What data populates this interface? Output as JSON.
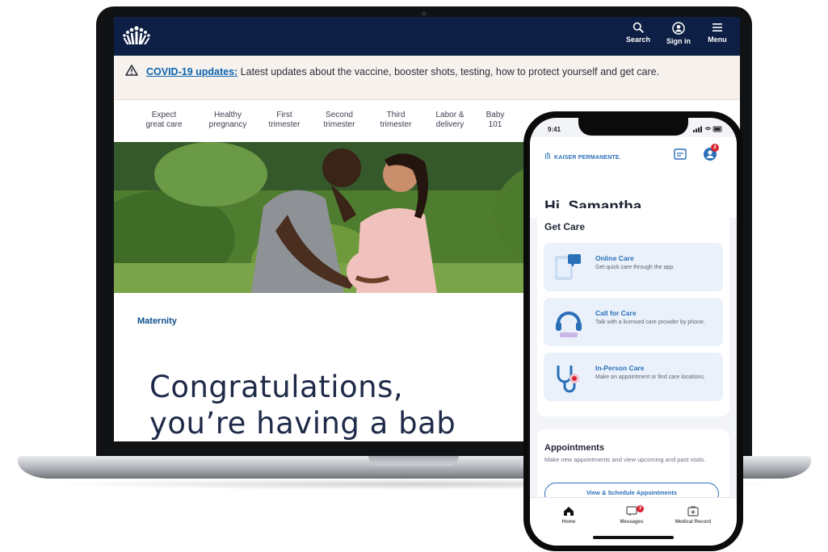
{
  "laptop": {
    "header": {
      "logo_icon": "kaiser-permanente-logo-icon",
      "search_label": "Search",
      "signin_label": "Sign in",
      "menu_label": "Menu",
      "bg_color": "#0d1f44"
    },
    "banner": {
      "icon": "warning-triangle-icon",
      "link_text": "COVID-19 updates:",
      "text": " Latest updates about the vaccine, booster shots, testing, how to protect yourself and get care."
    },
    "tabs": [
      {
        "line1": "Expect",
        "line2": "great care"
      },
      {
        "line1": "Healthy",
        "line2": "pregnancy"
      },
      {
        "line1": "First",
        "line2": "trimester"
      },
      {
        "line1": "Second",
        "line2": "trimester"
      },
      {
        "line1": "Third",
        "line2": "trimester"
      },
      {
        "line1": "Labor &",
        "line2": "delivery"
      },
      {
        "line1": "Baby",
        "line2": "101"
      }
    ],
    "section_label": "Maternity",
    "headline_line1": "Congratulations,",
    "headline_line2": "you’re having a bab"
  },
  "phone": {
    "status_time": "9:41",
    "app_logo_text": "KAISER PERMANENTE.",
    "notification_count": "2",
    "greeting": "Hi, Samantha",
    "get_care_title": "Get Care",
    "care_items": [
      {
        "title": "Online Care",
        "desc": "Get quick care through the app.",
        "icon": "chat-icon"
      },
      {
        "title": "Call for Care",
        "desc": "Talk with a licensed care provider by phone.",
        "icon": "headset-icon"
      },
      {
        "title": "In-Person Care",
        "desc": "Make an appointment or find care locations.",
        "icon": "stethoscope-icon"
      }
    ],
    "appointments_title": "Appointments",
    "appointments_desc": "Make new appointments and view upcoming and past visits.",
    "appointments_button": "View & Schedule Appointments",
    "tabbar": {
      "home": "Home",
      "messages": "Messages",
      "medical_record": "Medical Record",
      "messages_badge": "3"
    },
    "accent_color": "#2a6fb8"
  }
}
